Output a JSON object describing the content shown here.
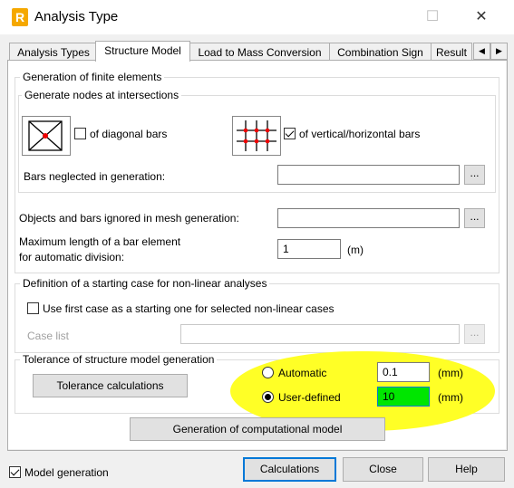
{
  "window": {
    "title": "Analysis Type",
    "minimize": "–",
    "maximize": "☐",
    "close": "✕",
    "app_icon_letter": "R"
  },
  "tabs": [
    "Analysis Types",
    "Structure Model",
    "Load to Mass Conversion",
    "Combination Sign",
    "Result"
  ],
  "tab_scroll": {
    "left": "◀",
    "right": "▶"
  },
  "fe_generation": {
    "legend": "Generation of finite elements",
    "nodes_legend": "Generate nodes at intersections",
    "diagonal_label": "of diagonal bars",
    "diagonal_checked": false,
    "vh_label": "of vertical/horizontal bars",
    "vh_checked": true,
    "bars_neglected_label": "Bars neglected in generation:",
    "bars_neglected_value": "",
    "objects_ignored_label": "Objects and bars ignored in mesh generation:",
    "objects_ignored_value": "",
    "max_length_label_1": "Maximum length of a bar element",
    "max_length_label_2": "for automatic division:",
    "max_length_value": "1",
    "max_length_unit": "(m)",
    "browse": "..."
  },
  "nonlinear": {
    "legend": "Definition of a starting case for non-linear analyses",
    "first_case_label": "Use first case as a starting one for selected non-linear cases",
    "first_case_checked": false,
    "case_list_label": "Case list",
    "case_list_value": ""
  },
  "tolerance": {
    "legend": "Tolerance of structure model generation",
    "calc_button": "Tolerance calculations",
    "automatic_label": "Automatic",
    "automatic_value": "0.1",
    "automatic_unit": "(mm)",
    "user_label": "User-defined",
    "user_value": "10",
    "user_unit": "(mm)",
    "selected": "User-defined"
  },
  "generate_button": "Generation of computational model",
  "footer": {
    "model_generation_label": "Model generation",
    "model_generation_checked": true,
    "calculations": "Calculations",
    "close": "Close",
    "help": "Help"
  },
  "colors": {
    "highlight": "#ffff26",
    "user_value_bg": "#00e600",
    "accent": "#0078d7"
  }
}
